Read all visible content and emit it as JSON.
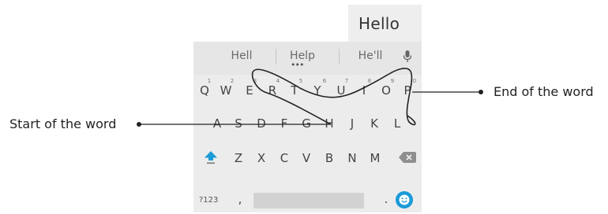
{
  "typed_word": "Hello",
  "suggestions": [
    "Hell",
    "Help",
    "He'll"
  ],
  "more_indicator": "•••",
  "row1_keys": [
    "Q",
    "W",
    "E",
    "R",
    "T",
    "Y",
    "U",
    "I",
    "O",
    "P"
  ],
  "row1_hints": [
    "1",
    "2",
    "3",
    "4",
    "5",
    "6",
    "7",
    "8",
    "9",
    "0"
  ],
  "row2_keys": [
    "A",
    "S",
    "D",
    "F",
    "G",
    "H",
    "J",
    "K",
    "L"
  ],
  "row3_keys": [
    "Z",
    "X",
    "C",
    "V",
    "B",
    "N",
    "M"
  ],
  "bottom_row": {
    "symbols": "?123",
    "comma": ",",
    "period": "."
  },
  "annotations": {
    "start": "Start of the word",
    "end": "End of the word"
  },
  "colors": {
    "accent": "#1a9bd7",
    "path": "#222222",
    "label": "#222222"
  },
  "icons": [
    "microphone-icon",
    "shift-icon",
    "backspace-icon",
    "emoji-icon"
  ]
}
